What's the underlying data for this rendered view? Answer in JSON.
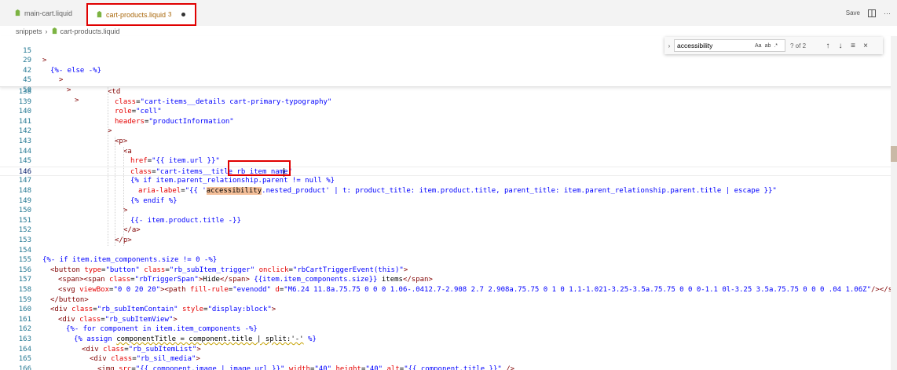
{
  "tabs": [
    {
      "label": "main-cart.liquid"
    },
    {
      "label": "cart-products.liquid",
      "problems": "3"
    }
  ],
  "toolbar": {
    "save_label": "Save"
  },
  "breadcrumb": {
    "folder": "snippets",
    "file": "cart-products.liquid"
  },
  "find": {
    "value": "accessibility",
    "count": "? of 2",
    "opt_case": "Aa",
    "opt_word": "ab",
    "opt_regex": ".*"
  },
  "sticky_lines": [
    {
      "num": "15",
      "text": ">"
    },
    {
      "num": "29",
      "text": "{%- else -%}"
    },
    {
      "num": "42",
      "text": ">"
    },
    {
      "num": "45",
      "text": ">"
    },
    {
      "num": "50",
      "text": ">"
    }
  ],
  "lines": [
    {
      "num": "138",
      "parts": [
        [
          "<td",
          "tag"
        ]
      ]
    },
    {
      "num": "139",
      "parts": [
        [
          "class",
          "attr"
        ],
        [
          "=",
          "plain"
        ],
        [
          "\"cart-items__details cart-primary-typography\"",
          "str"
        ]
      ]
    },
    {
      "num": "140",
      "parts": [
        [
          "role",
          "attr"
        ],
        [
          "=",
          "plain"
        ],
        [
          "\"cell\"",
          "str"
        ]
      ]
    },
    {
      "num": "141",
      "parts": [
        [
          "headers",
          "attr"
        ],
        [
          "=",
          "plain"
        ],
        [
          "\"productInformation\"",
          "str"
        ]
      ]
    },
    {
      "num": "142",
      "parts": [
        [
          ">",
          "tag"
        ]
      ]
    },
    {
      "num": "143",
      "parts": [
        [
          "<p>",
          "tag"
        ]
      ]
    },
    {
      "num": "144",
      "parts": [
        [
          "<a",
          "tag"
        ]
      ]
    },
    {
      "num": "145",
      "parts": [
        [
          "href",
          "attr"
        ],
        [
          "=",
          "plain"
        ],
        [
          "\"{{ item.url }}\"",
          "str"
        ]
      ]
    },
    {
      "num": "146",
      "parts": [
        [
          "class",
          "attr"
        ],
        [
          "=",
          "plain"
        ],
        [
          "\"cart-items__title rb_item_name\"",
          "str"
        ]
      ]
    },
    {
      "num": "147",
      "parts": [
        [
          "{% if item.parent_relationship.parent != null %}",
          "lq"
        ]
      ]
    },
    {
      "num": "148",
      "parts": [
        [
          "aria-label",
          "attr"
        ],
        [
          "=",
          "plain"
        ],
        [
          "\"{{ '",
          "str"
        ],
        [
          "accessibility",
          "hl"
        ],
        [
          ".nested_product' | t: product_title: item.product.title, parent_title: item.parent_relationship.parent.title | escape }}\"",
          "str"
        ]
      ]
    },
    {
      "num": "149",
      "parts": [
        [
          "{% endif %}",
          "lq"
        ]
      ]
    },
    {
      "num": "150",
      "parts": [
        [
          ">",
          "tag"
        ]
      ]
    },
    {
      "num": "151",
      "parts": [
        [
          "{{- item.product.title -}}",
          "lq"
        ]
      ]
    },
    {
      "num": "152",
      "parts": [
        [
          "</a>",
          "tag"
        ]
      ]
    },
    {
      "num": "153",
      "parts": [
        [
          "</p>",
          "tag"
        ]
      ]
    },
    {
      "num": "154",
      "parts": []
    },
    {
      "num": "155",
      "parts": [
        [
          "{%- if item.item_components.size != 0 -%}",
          "lq"
        ]
      ]
    },
    {
      "num": "156",
      "parts": [
        [
          "<button ",
          "tag"
        ],
        [
          "type",
          "attr"
        ],
        [
          "=",
          "plain"
        ],
        [
          "\"button\" ",
          "str"
        ],
        [
          "class",
          "attr"
        ],
        [
          "=",
          "plain"
        ],
        [
          "\"rb_subItem_trigger\" ",
          "str"
        ],
        [
          "onclick",
          "attr"
        ],
        [
          "=",
          "plain"
        ],
        [
          "\"rbCartTriggerEvent(this)\"",
          "str"
        ],
        [
          ">",
          "tag"
        ]
      ]
    },
    {
      "num": "157",
      "parts": [
        [
          "<span><span ",
          "tag"
        ],
        [
          "class",
          "attr"
        ],
        [
          "=",
          "plain"
        ],
        [
          "\"rbTriggerSpan\"",
          "str"
        ],
        [
          ">",
          "tag"
        ],
        [
          "Hide",
          "plain"
        ],
        [
          "</span>",
          "tag"
        ],
        [
          " {{item.item_components.size}} ",
          "lq"
        ],
        [
          "items",
          "plain"
        ],
        [
          "</span>",
          "tag"
        ]
      ]
    },
    {
      "num": "158",
      "parts": [
        [
          "<svg ",
          "tag"
        ],
        [
          "viewBox",
          "attr"
        ],
        [
          "=",
          "plain"
        ],
        [
          "\"0 0 20 20\"",
          "str"
        ],
        [
          "><path ",
          "tag"
        ],
        [
          "fill-rule",
          "attr"
        ],
        [
          "=",
          "plain"
        ],
        [
          "\"evenodd\" ",
          "str"
        ],
        [
          "d",
          "attr"
        ],
        [
          "=",
          "plain"
        ],
        [
          "\"M6.24 11.8a.75.75 0 0 0 1.06-.0412.7-2.908 2.7 2.908a.75.75 0 1 0 1.1-1.021-3.25-3.5a.75.75 0 0 0-1.1 0l-3.25 3.5a.75.75 0 0 0 .04 1.06Z\"",
          "str"
        ],
        [
          "/></svg>",
          "tag"
        ]
      ]
    },
    {
      "num": "159",
      "parts": [
        [
          "</button>",
          "tag"
        ]
      ]
    },
    {
      "num": "160",
      "parts": [
        [
          "<div ",
          "tag"
        ],
        [
          "class",
          "attr"
        ],
        [
          "=",
          "plain"
        ],
        [
          "\"rb_subItemContain\" ",
          "str"
        ],
        [
          "style",
          "attr"
        ],
        [
          "=",
          "plain"
        ],
        [
          "\"display:block\"",
          "str"
        ],
        [
          ">",
          "tag"
        ]
      ]
    },
    {
      "num": "161",
      "parts": [
        [
          "<div ",
          "tag"
        ],
        [
          "class",
          "attr"
        ],
        [
          "=",
          "plain"
        ],
        [
          "\"rb_subItemView\"",
          "str"
        ],
        [
          ">",
          "tag"
        ]
      ]
    },
    {
      "num": "162",
      "parts": [
        [
          "{%- for component in item.item_components -%}",
          "lq"
        ]
      ]
    },
    {
      "num": "163",
      "parts": [
        [
          "{% assign ",
          "lq"
        ],
        [
          "componentTitle = component.title | split:'-'",
          "squig"
        ],
        [
          " %}",
          "lq"
        ]
      ]
    },
    {
      "num": "164",
      "parts": [
        [
          "<div ",
          "tag"
        ],
        [
          "class",
          "attr"
        ],
        [
          "=",
          "plain"
        ],
        [
          "\"rb_subItemList\"",
          "str"
        ],
        [
          ">",
          "tag"
        ]
      ]
    },
    {
      "num": "165",
      "parts": [
        [
          "<div ",
          "tag"
        ],
        [
          "class",
          "attr"
        ],
        [
          "=",
          "plain"
        ],
        [
          "\"rb_sil_media\"",
          "str"
        ],
        [
          ">",
          "tag"
        ]
      ]
    },
    {
      "num": "166",
      "parts": [
        [
          "<img ",
          "tag"
        ],
        [
          "src",
          "attr"
        ],
        [
          "=",
          "plain"
        ],
        [
          "\"{{ component.image | image_url }}\" ",
          "str"
        ],
        [
          "width",
          "attr"
        ],
        [
          "=",
          "plain"
        ],
        [
          "\"40\" ",
          "str"
        ],
        [
          "height",
          "attr"
        ],
        [
          "=",
          "plain"
        ],
        [
          "\"40\" ",
          "str"
        ],
        [
          "alt",
          "attr"
        ],
        [
          "=",
          "plain"
        ],
        [
          "\"{{ component.title }}\"",
          "str"
        ],
        [
          " />",
          "tag"
        ]
      ]
    }
  ],
  "colors": {
    "accent": "#e00000",
    "line_number": "#237893",
    "tag": "#800000",
    "attr": "#e50000",
    "string": "#0000ff",
    "match": "#f4bf99"
  },
  "icons": [
    "liquid-file-icon",
    "split-editor-icon",
    "more-actions-icon",
    "close-icon",
    "arrow-up-icon",
    "arrow-down-icon",
    "selection-icon"
  ]
}
